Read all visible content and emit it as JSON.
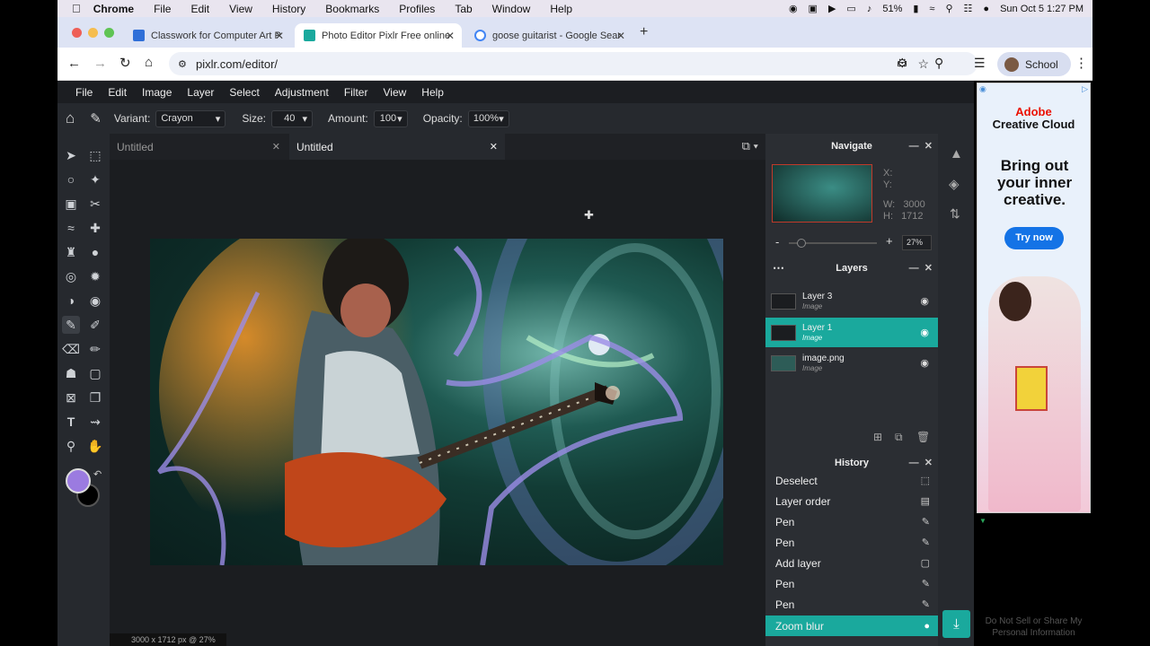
{
  "macbar": {
    "app": "Chrome",
    "menus": [
      "File",
      "Edit",
      "View",
      "History",
      "Bookmarks",
      "Profiles",
      "Tab",
      "Window",
      "Help"
    ],
    "battery": "51%",
    "clock": "Sun Oct 5  1:27 PM"
  },
  "browser": {
    "tabs": [
      {
        "label": "Classwork for Computer Art P"
      },
      {
        "label": "Photo Editor Pixlr Free online"
      },
      {
        "label": "goose guitarist - Google Sear"
      }
    ],
    "url": "pixlr.com/editor/",
    "profile": "School"
  },
  "pixlr": {
    "menu": [
      "File",
      "Edit",
      "Image",
      "Layer",
      "Select",
      "Adjustment",
      "Filter",
      "View",
      "Help"
    ],
    "options": {
      "variant_label": "Variant:",
      "variant": "Crayon",
      "size_label": "Size:",
      "size": "40",
      "amount_label": "Amount:",
      "amount": "100",
      "opacity_label": "Opacity:",
      "opacity": "100%"
    },
    "doc_tabs": [
      "Untitled",
      "Untitled"
    ],
    "navigate": {
      "title": "Navigate",
      "x": "X:",
      "y": "Y:",
      "w_label": "W:",
      "w": "3000",
      "h_label": "H:",
      "h": "1712",
      "zoom": "27%",
      "minus": "-",
      "plus": "+"
    },
    "layers": {
      "title": "Layers",
      "items": [
        {
          "name": "Layer 3",
          "type": "Image"
        },
        {
          "name": "Layer 1",
          "type": "Image"
        },
        {
          "name": "image.png",
          "type": "Image"
        }
      ]
    },
    "history": {
      "title": "History",
      "items": [
        "Deselect",
        "Layer order",
        "Pen",
        "Pen",
        "Add layer",
        "Pen",
        "Pen",
        "Zoom blur"
      ]
    },
    "status": "3000 x 1712 px @ 27%",
    "colors": {
      "primary": "#9b7be0",
      "secondary": "#000000",
      "accent": "#1aa99d"
    }
  },
  "ad": {
    "brand": "Adobe",
    "product": "Creative Cloud",
    "headline": "Bring out your inner creative.",
    "cta": "Try now",
    "footer": "Do Not Sell or Share My Personal Information"
  }
}
